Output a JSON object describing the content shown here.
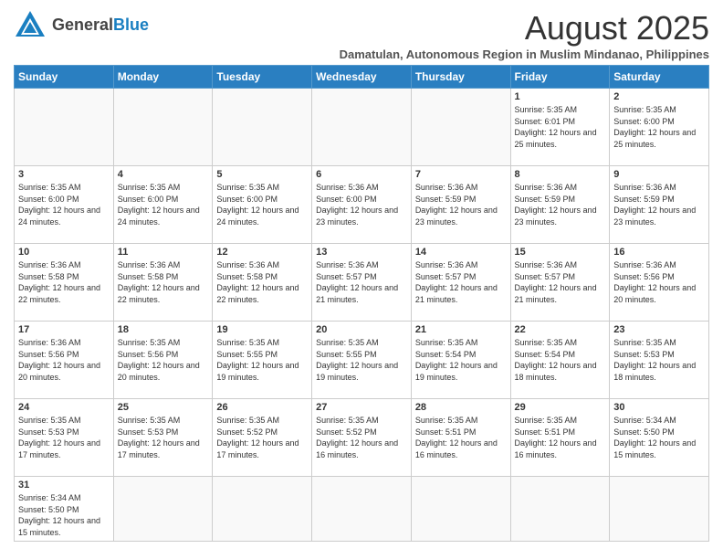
{
  "header": {
    "logo_general": "General",
    "logo_blue": "Blue",
    "month_title": "August 2025",
    "subtitle": "Damatulan, Autonomous Region in Muslim Mindanao, Philippines"
  },
  "weekdays": [
    "Sunday",
    "Monday",
    "Tuesday",
    "Wednesday",
    "Thursday",
    "Friday",
    "Saturday"
  ],
  "weeks": [
    {
      "days": [
        {
          "number": "",
          "info": ""
        },
        {
          "number": "",
          "info": ""
        },
        {
          "number": "",
          "info": ""
        },
        {
          "number": "",
          "info": ""
        },
        {
          "number": "",
          "info": ""
        },
        {
          "number": "1",
          "info": "Sunrise: 5:35 AM\nSunset: 6:01 PM\nDaylight: 12 hours and 25 minutes."
        },
        {
          "number": "2",
          "info": "Sunrise: 5:35 AM\nSunset: 6:00 PM\nDaylight: 12 hours and 25 minutes."
        }
      ]
    },
    {
      "days": [
        {
          "number": "3",
          "info": "Sunrise: 5:35 AM\nSunset: 6:00 PM\nDaylight: 12 hours and 24 minutes."
        },
        {
          "number": "4",
          "info": "Sunrise: 5:35 AM\nSunset: 6:00 PM\nDaylight: 12 hours and 24 minutes."
        },
        {
          "number": "5",
          "info": "Sunrise: 5:35 AM\nSunset: 6:00 PM\nDaylight: 12 hours and 24 minutes."
        },
        {
          "number": "6",
          "info": "Sunrise: 5:36 AM\nSunset: 6:00 PM\nDaylight: 12 hours and 23 minutes."
        },
        {
          "number": "7",
          "info": "Sunrise: 5:36 AM\nSunset: 5:59 PM\nDaylight: 12 hours and 23 minutes."
        },
        {
          "number": "8",
          "info": "Sunrise: 5:36 AM\nSunset: 5:59 PM\nDaylight: 12 hours and 23 minutes."
        },
        {
          "number": "9",
          "info": "Sunrise: 5:36 AM\nSunset: 5:59 PM\nDaylight: 12 hours and 23 minutes."
        }
      ]
    },
    {
      "days": [
        {
          "number": "10",
          "info": "Sunrise: 5:36 AM\nSunset: 5:58 PM\nDaylight: 12 hours and 22 minutes."
        },
        {
          "number": "11",
          "info": "Sunrise: 5:36 AM\nSunset: 5:58 PM\nDaylight: 12 hours and 22 minutes."
        },
        {
          "number": "12",
          "info": "Sunrise: 5:36 AM\nSunset: 5:58 PM\nDaylight: 12 hours and 22 minutes."
        },
        {
          "number": "13",
          "info": "Sunrise: 5:36 AM\nSunset: 5:57 PM\nDaylight: 12 hours and 21 minutes."
        },
        {
          "number": "14",
          "info": "Sunrise: 5:36 AM\nSunset: 5:57 PM\nDaylight: 12 hours and 21 minutes."
        },
        {
          "number": "15",
          "info": "Sunrise: 5:36 AM\nSunset: 5:57 PM\nDaylight: 12 hours and 21 minutes."
        },
        {
          "number": "16",
          "info": "Sunrise: 5:36 AM\nSunset: 5:56 PM\nDaylight: 12 hours and 20 minutes."
        }
      ]
    },
    {
      "days": [
        {
          "number": "17",
          "info": "Sunrise: 5:36 AM\nSunset: 5:56 PM\nDaylight: 12 hours and 20 minutes."
        },
        {
          "number": "18",
          "info": "Sunrise: 5:35 AM\nSunset: 5:56 PM\nDaylight: 12 hours and 20 minutes."
        },
        {
          "number": "19",
          "info": "Sunrise: 5:35 AM\nSunset: 5:55 PM\nDaylight: 12 hours and 19 minutes."
        },
        {
          "number": "20",
          "info": "Sunrise: 5:35 AM\nSunset: 5:55 PM\nDaylight: 12 hours and 19 minutes."
        },
        {
          "number": "21",
          "info": "Sunrise: 5:35 AM\nSunset: 5:54 PM\nDaylight: 12 hours and 19 minutes."
        },
        {
          "number": "22",
          "info": "Sunrise: 5:35 AM\nSunset: 5:54 PM\nDaylight: 12 hours and 18 minutes."
        },
        {
          "number": "23",
          "info": "Sunrise: 5:35 AM\nSunset: 5:53 PM\nDaylight: 12 hours and 18 minutes."
        }
      ]
    },
    {
      "days": [
        {
          "number": "24",
          "info": "Sunrise: 5:35 AM\nSunset: 5:53 PM\nDaylight: 12 hours and 17 minutes."
        },
        {
          "number": "25",
          "info": "Sunrise: 5:35 AM\nSunset: 5:53 PM\nDaylight: 12 hours and 17 minutes."
        },
        {
          "number": "26",
          "info": "Sunrise: 5:35 AM\nSunset: 5:52 PM\nDaylight: 12 hours and 17 minutes."
        },
        {
          "number": "27",
          "info": "Sunrise: 5:35 AM\nSunset: 5:52 PM\nDaylight: 12 hours and 16 minutes."
        },
        {
          "number": "28",
          "info": "Sunrise: 5:35 AM\nSunset: 5:51 PM\nDaylight: 12 hours and 16 minutes."
        },
        {
          "number": "29",
          "info": "Sunrise: 5:35 AM\nSunset: 5:51 PM\nDaylight: 12 hours and 16 minutes."
        },
        {
          "number": "30",
          "info": "Sunrise: 5:34 AM\nSunset: 5:50 PM\nDaylight: 12 hours and 15 minutes."
        }
      ]
    },
    {
      "days": [
        {
          "number": "31",
          "info": "Sunrise: 5:34 AM\nSunset: 5:50 PM\nDaylight: 12 hours and 15 minutes."
        },
        {
          "number": "",
          "info": ""
        },
        {
          "number": "",
          "info": ""
        },
        {
          "number": "",
          "info": ""
        },
        {
          "number": "",
          "info": ""
        },
        {
          "number": "",
          "info": ""
        },
        {
          "number": "",
          "info": ""
        }
      ]
    }
  ]
}
